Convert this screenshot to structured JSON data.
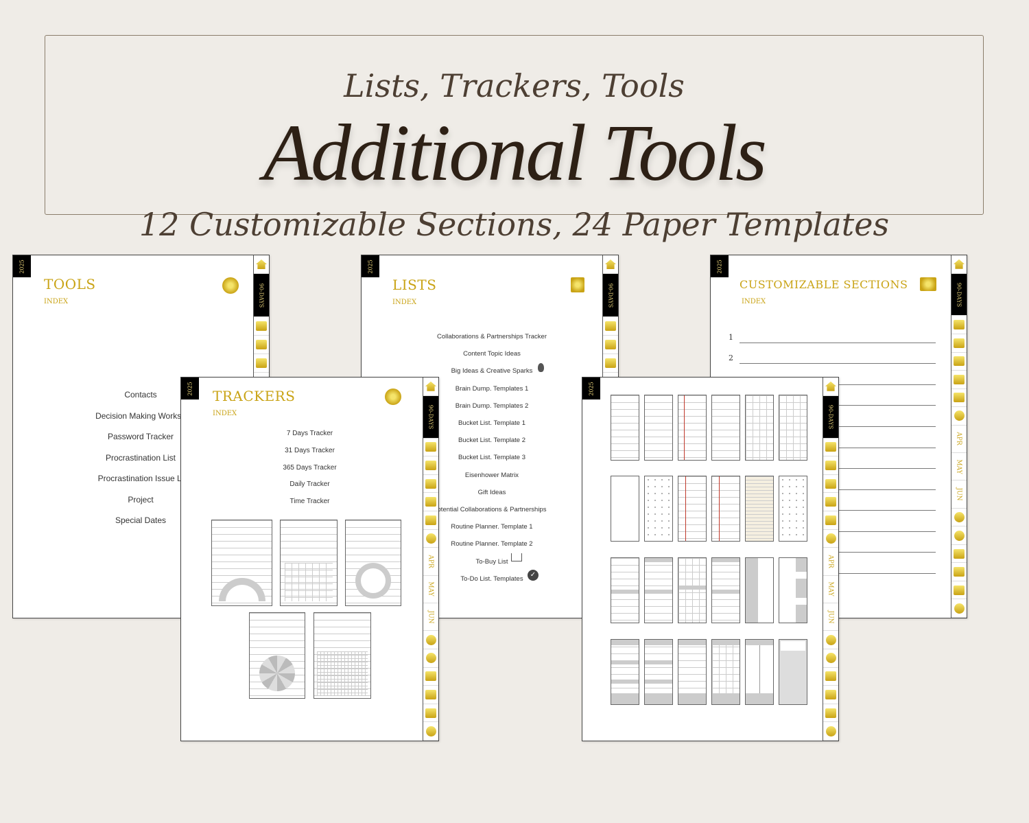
{
  "banner": {
    "subtitle": "Lists, Trackers, Tools",
    "title": "Additional Tools",
    "tagline": "12 Customizable Sections, 24 Paper Templates"
  },
  "year": "2025",
  "tab_labels": {
    "days": "90-DAYS",
    "months": [
      "APR",
      "MAY",
      "JUN"
    ]
  },
  "tools_page": {
    "title": "TOOLS",
    "index_label": "INDEX",
    "items": [
      "Contacts",
      "Decision Making Worksh",
      "Password Tracker",
      "Procrastination List",
      "Procrastination Issue Li",
      "Project",
      "Special Dates"
    ]
  },
  "lists_page": {
    "title": "LISTS",
    "index_label": "INDEX",
    "items": [
      "Collaborations & Partnerships Tracker",
      "Content Topic Ideas",
      "Big Ideas & Creative Sparks",
      "Brain Dump. Templates 1",
      "Brain Dump. Templates 2",
      "Bucket List. Template 1",
      "Bucket List. Template 2",
      "Bucket List. Template 3",
      "Eisenhower Matrix",
      "Gift Ideas",
      "otential Collaborations & Partnerships",
      "Routine Planner. Template 1",
      "Routine Planner. Template 2",
      "To-Buy List",
      "To-Do List. Templates"
    ]
  },
  "custom_page": {
    "title": "CUSTOMIZABLE SECTIONS",
    "index_label": "INDEX",
    "numbers": [
      "1",
      "2"
    ]
  },
  "trackers_page": {
    "title": "TRACKERS",
    "index_label": "INDEX",
    "items": [
      "7 Days Tracker",
      "31 Days Tracker",
      "365 Days Tracker",
      "Daily Tracker",
      "Time Tracker"
    ]
  }
}
